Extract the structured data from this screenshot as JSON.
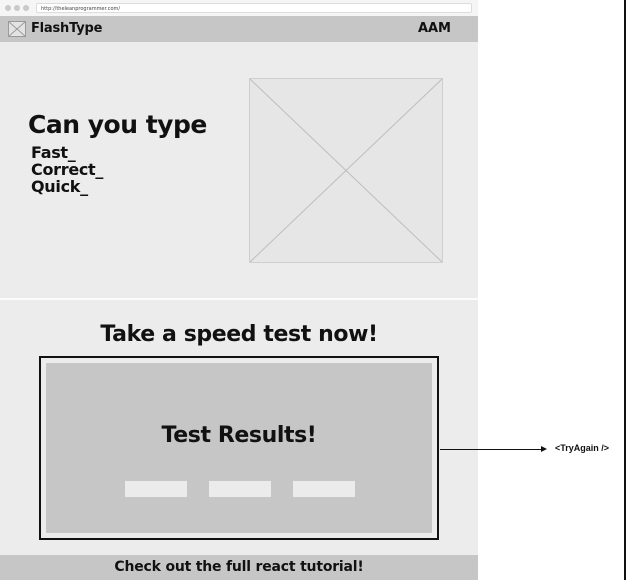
{
  "browser": {
    "url": "http://theleanprogrammer.com/"
  },
  "header": {
    "logo_icon": "image-placeholder-icon",
    "brand": "FlashType",
    "right_text": "AAM"
  },
  "hero": {
    "title": "Can you type",
    "lines": [
      "Fast_",
      "Correct_",
      "Quick_"
    ],
    "image_icon": "image-placeholder-icon"
  },
  "speed_test": {
    "heading": "Take a speed test now!",
    "results_title": "Test Results!",
    "annotation": "<TryAgain />"
  },
  "footer": {
    "text": "Check out the full react tutorial!"
  }
}
